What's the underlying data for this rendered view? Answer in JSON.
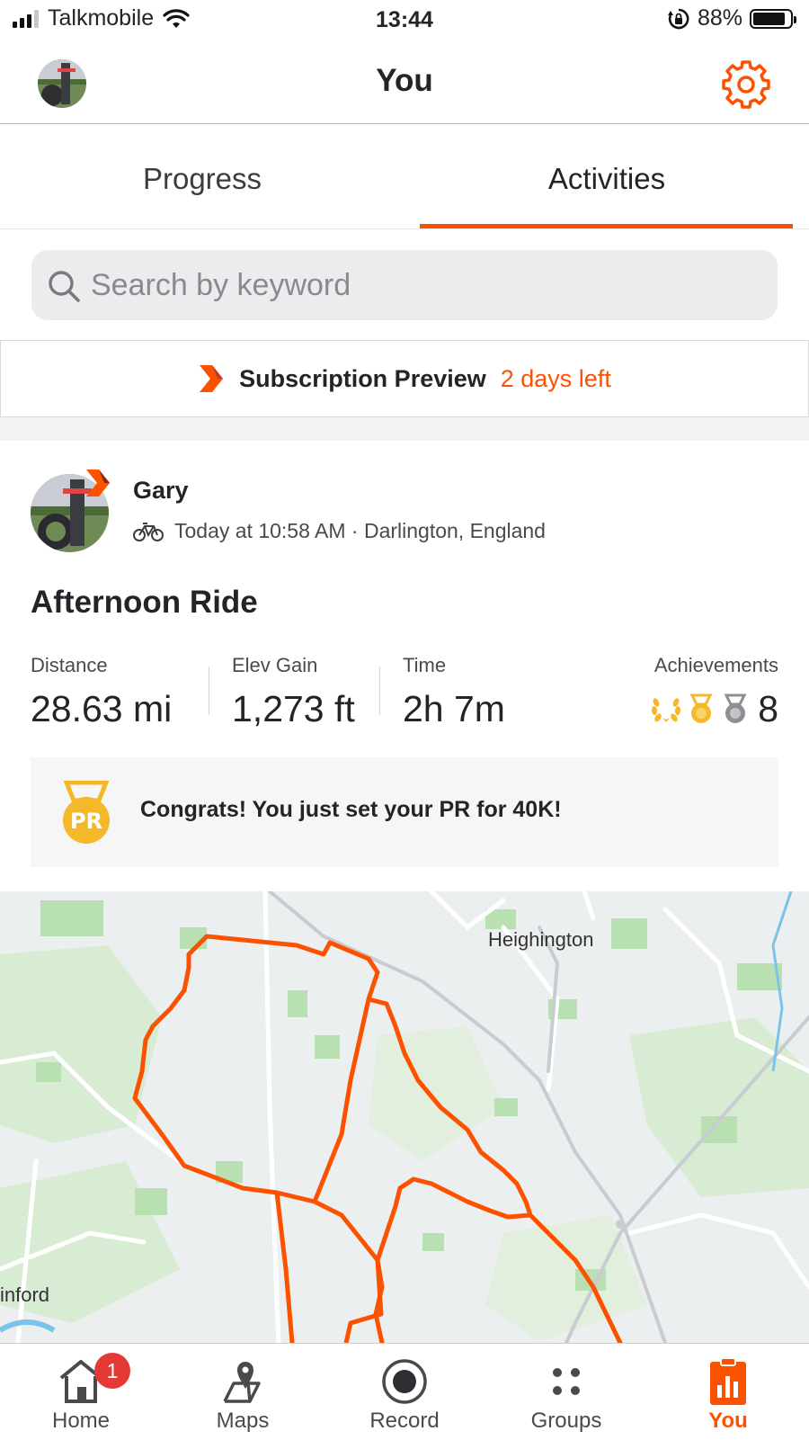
{
  "status_bar": {
    "carrier": "Talkmobile",
    "time": "13:44",
    "battery_percent": "88%",
    "battery_level": 0.88
  },
  "header": {
    "title": "You"
  },
  "tabs": [
    {
      "label": "Progress",
      "active": false
    },
    {
      "label": "Activities",
      "active": true
    }
  ],
  "search": {
    "placeholder": "Search by keyword"
  },
  "subscription": {
    "label": "Subscription Preview",
    "days_left": "2 days left"
  },
  "activity": {
    "athlete": "Gary",
    "meta": "Today at 10:58 AM · Darlington, England",
    "title": "Afternoon Ride",
    "stats": [
      {
        "label": "Distance",
        "value": "28.63 mi"
      },
      {
        "label": "Elev Gain",
        "value": "1,273 ft"
      },
      {
        "label": "Time",
        "value": "2h 7m"
      }
    ],
    "achievements": {
      "label": "Achievements",
      "count": "8"
    },
    "pr_message": "Congrats! You just set your PR for 40K!",
    "pr_badge_text": "PR"
  },
  "map": {
    "labels": [
      "Heighington",
      "inford"
    ]
  },
  "bottom_nav": [
    {
      "label": "Home",
      "badge": "1",
      "icon": "home-icon"
    },
    {
      "label": "Maps",
      "icon": "maps-icon"
    },
    {
      "label": "Record",
      "icon": "record-icon"
    },
    {
      "label": "Groups",
      "icon": "groups-icon"
    },
    {
      "label": "You",
      "icon": "you-icon",
      "active": true
    }
  ],
  "colors": {
    "accent": "#fc5200",
    "gold": "#f5b829",
    "silver": "#8e8e93"
  }
}
